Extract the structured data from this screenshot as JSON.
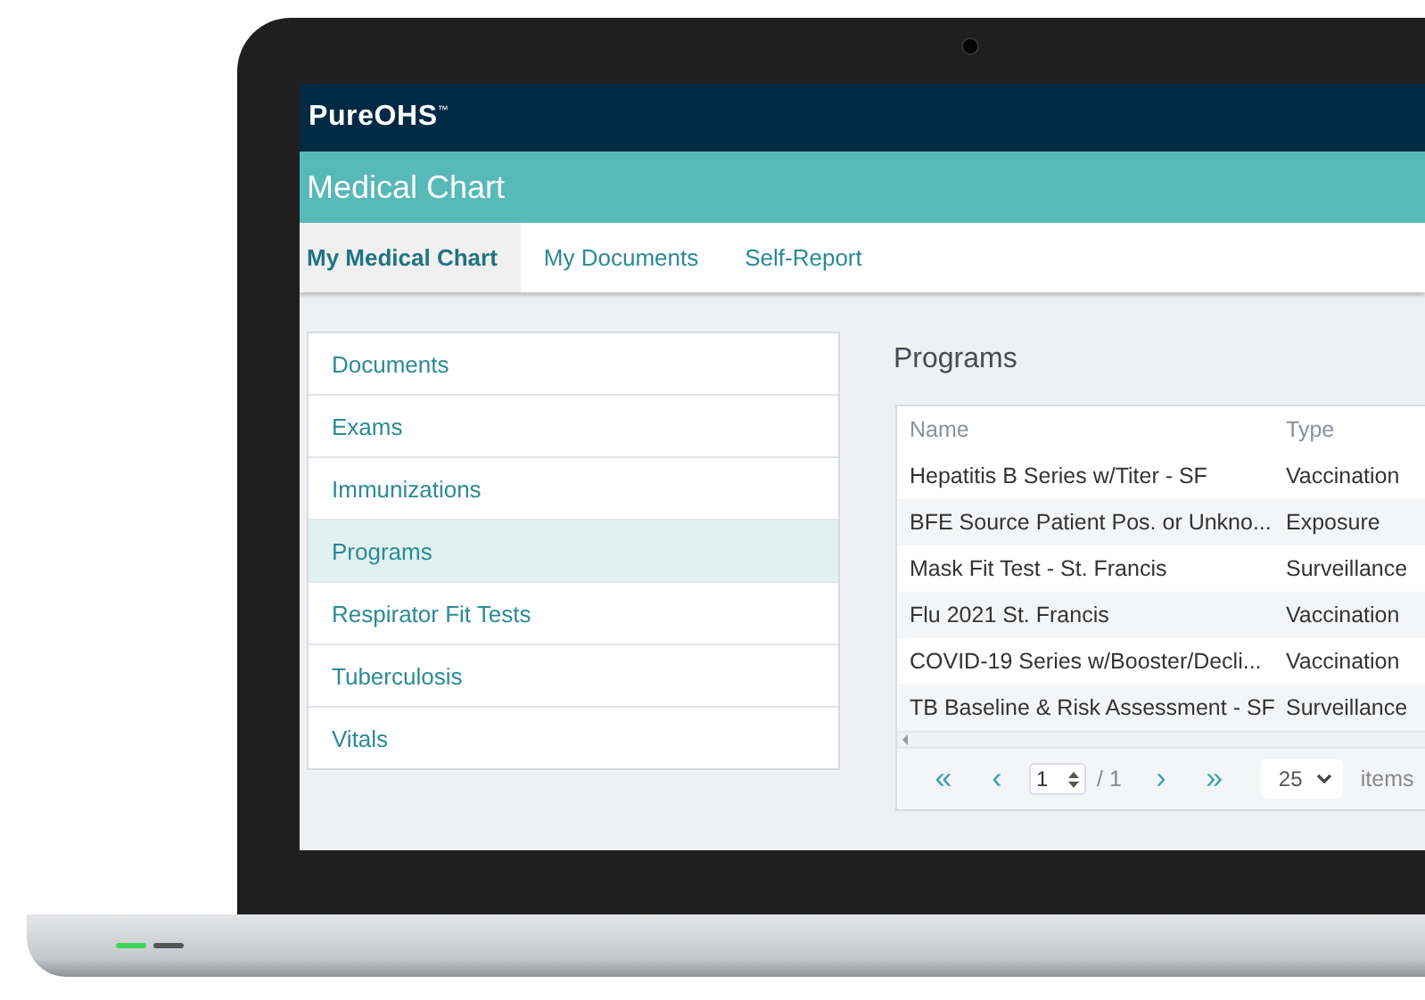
{
  "app": {
    "brand": "PureOHS$^{™}$",
    "page_title": "Medical Chart"
  },
  "tabs": [
    {
      "label": "My Medical Chart",
      "selected": true
    },
    {
      "label": "My Documents",
      "selected": false
    },
    {
      "label": "Self-Report",
      "selected": false
    }
  ],
  "sidebar": {
    "items": [
      {
        "label": "Documents",
        "selected": false
      },
      {
        "label": "Exams",
        "selected": false
      },
      {
        "label": "Immunizations",
        "selected": false
      },
      {
        "label": "Programs",
        "selected": true
      },
      {
        "label": "Respirator Fit Tests",
        "selected": false
      },
      {
        "label": "Tuberculosis",
        "selected": false
      },
      {
        "label": "Vitals",
        "selected": false
      }
    ]
  },
  "section_title": "Programs",
  "table": {
    "columns": [
      "Name",
      "Type"
    ],
    "rows": [
      [
        "Hepatitis B Series w/Titer - SF",
        "Vaccination"
      ],
      [
        "BFE Source Patient Pos. or Unkno...",
        "Exposure"
      ],
      [
        "Mask Fit Test - St. Francis",
        "Surveillance"
      ],
      [
        "Flu 2021 St. Francis",
        "Vaccination"
      ],
      [
        "COVID-19 Series w/Booster/Decli...",
        "Vaccination"
      ],
      [
        "TB Baseline & Risk Assessment - SF",
        "Surveillance"
      ]
    ]
  },
  "pager": {
    "first": "«",
    "prev": "‹",
    "page": "1",
    "total": "/ 1",
    "next": "›",
    "last": "»",
    "page_size": "25",
    "page_size_label": "items"
  }
}
